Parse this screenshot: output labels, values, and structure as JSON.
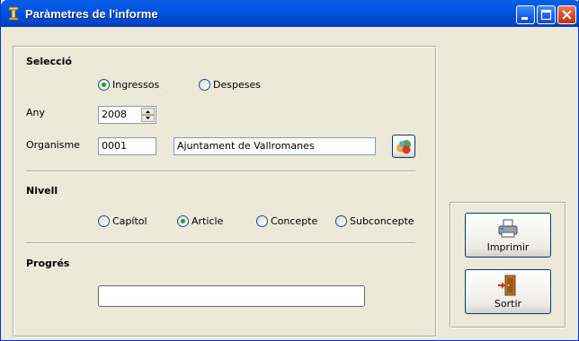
{
  "window": {
    "title": "Paràmetres de l'informe"
  },
  "seleccio": {
    "title": "Selecció",
    "options": [
      "Ingressos",
      "Despeses"
    ],
    "selected": "Ingressos",
    "any_label": "Any",
    "any_value": "2008",
    "organisme_label": "Organisme",
    "organisme_code": "0001",
    "organisme_name": "Ajuntament de Vallromanes"
  },
  "nivell": {
    "title": "Nivell",
    "options": [
      "Capítol",
      "Article",
      "Concepte",
      "Subconcepte"
    ],
    "selected": "Article"
  },
  "progres": {
    "title": "Progrés",
    "value": 0
  },
  "buttons": {
    "imprimir": "Imprimir",
    "sortir": "Sortir"
  },
  "colors": {
    "titlebar": "#0054e3",
    "face": "#ece9d8",
    "radio_dot": "#21a121"
  }
}
